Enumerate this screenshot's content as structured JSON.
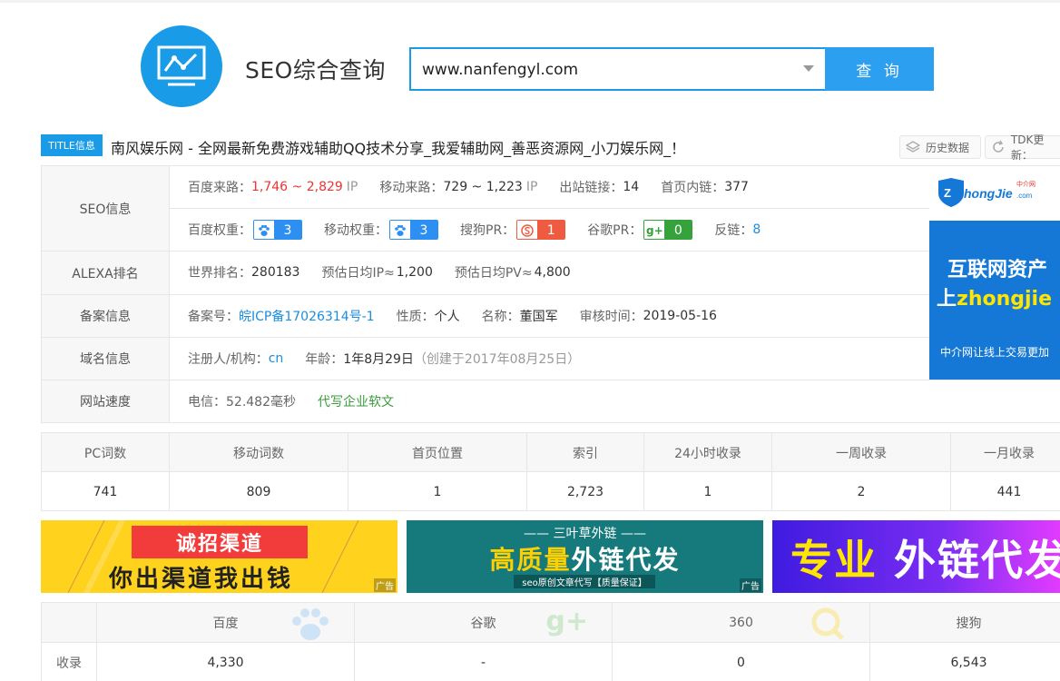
{
  "header": {
    "title": "SEO综合查询",
    "search_value": "www.nanfengyl.com",
    "search_button": "查 询"
  },
  "title_bar": {
    "tag": "TITLE信息",
    "text": "南风娱乐网 - 全网最新免费游戏辅助QQ技术分享_我爱辅助网_善恶资源网_小刀娱乐网_！",
    "history_button": "历史数据",
    "tdk_button": "TDK更新："
  },
  "seo_info": {
    "label": "SEO信息",
    "baidu_traffic_label": "百度来路：",
    "baidu_traffic_value": "1,746 ~ 2,829",
    "ip_unit": "IP",
    "mobile_traffic_label": "移动来路：",
    "mobile_traffic_value": "729 ~ 1,223",
    "outlinks_label": "出站链接：",
    "outlinks_value": "14",
    "inlinks_label": "首页内链：",
    "inlinks_value": "377",
    "baidu_weight_label": "百度权重：",
    "baidu_weight_value": "3",
    "mobile_weight_label": "移动权重：",
    "mobile_weight_value": "3",
    "sogou_pr_label": "搜狗PR：",
    "sogou_pr_value": "1",
    "google_pr_label": "谷歌PR：",
    "google_pr_value": "0",
    "backlinks_label": "反链：",
    "backlinks_value": "8"
  },
  "alexa": {
    "label": "ALEXA排名",
    "world_rank_label": "世界排名：",
    "world_rank_value": "280183",
    "daily_ip_label": "预估日均IP≈",
    "daily_ip_value": "1,200",
    "daily_pv_label": "预估日均PV≈",
    "daily_pv_value": "4,800"
  },
  "icp": {
    "label": "备案信息",
    "no_label": "备案号：",
    "no_value": "皖ICP备17026314号-1",
    "nature_label": "性质：",
    "nature_value": "个人",
    "name_label": "名称：",
    "name_value": "董国军",
    "audit_label": "审核时间：",
    "audit_value": "2019-05-16"
  },
  "domain": {
    "label": "域名信息",
    "registrant_label": "注册人/机构：",
    "registrant_value": "cn",
    "age_label": "年龄：",
    "age_value": "1年8月29日",
    "created_value": "（创建于2017年08月25日）"
  },
  "speed": {
    "label": "网站速度",
    "telecom_value": "电信：52.482毫秒",
    "promo_link": "代写企业软文"
  },
  "zhongjie_ad": {
    "logo_text": "Zhongjie.com",
    "logo_small": "中介网",
    "line1": "互联网资产",
    "line2_prefix": "上",
    "line2_highlight": "zhongjie",
    "line3": "中介网让线上交易更加"
  },
  "stats": {
    "headers": [
      "PC词数",
      "移动词数",
      "首页位置",
      "索引",
      "24小时收录",
      "一周收录",
      "一月收录"
    ],
    "values": [
      "741",
      "809",
      "1",
      "2,723",
      "1",
      "2",
      "441"
    ]
  },
  "banners": {
    "ad_tag": "广告",
    "b1_top": "诚招渠道",
    "b1_bottom": "你出渠道我出钱",
    "b2_top": "—— 三叶草外链 ——",
    "b2_mid_a": "高质量",
    "b2_mid_b": "外链代发",
    "b2_bottom": "seo原创文章代写【质量保证】",
    "b3_a": "专业",
    "b3_b": " 外链代发"
  },
  "index_table": {
    "row_label": "收录",
    "engines": [
      "百度",
      "谷歌",
      "360",
      "搜狗"
    ],
    "values": [
      "4,330",
      "-",
      "0",
      "6,543"
    ]
  },
  "colors": {
    "brand_blue": "#1a9be8",
    "baidu_red": "#ee3333",
    "badge_blue": "#2d8ff2",
    "badge_red": "#ef5b41",
    "badge_green": "#35a23b"
  }
}
